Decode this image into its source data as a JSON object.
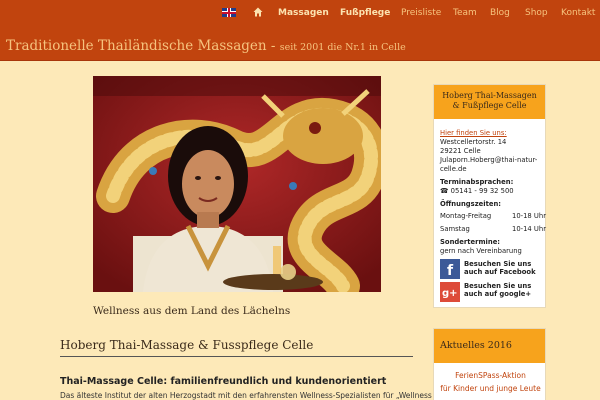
{
  "nav": {
    "items": [
      {
        "label": "Massagen",
        "bold": true
      },
      {
        "label": "Fußpflege",
        "bold": true
      },
      {
        "label": "Preisliste",
        "bold": false
      },
      {
        "label": "Team",
        "bold": false
      },
      {
        "label": "Blog",
        "bold": false
      },
      {
        "label": "Shop",
        "bold": false
      },
      {
        "label": "Kontakt",
        "bold": false
      }
    ],
    "icons": [
      "uk-flag-icon",
      "home-icon"
    ]
  },
  "header": {
    "title": "Traditionelle Thailändische Massagen",
    "separator": " - ",
    "subtitle": "seit 2001 die Nr.1 in Celle"
  },
  "hero": {
    "caption": "Wellness aus dem Land des Lächelns"
  },
  "main": {
    "section_title": "Hoberg Thai-Massage & Fusspflege Celle",
    "sub_heading": "Thai-Massage Celle: familienfreundlich und kundenorientiert",
    "body_text": "Das älteste Institut der alten Herzogstadt mit den erfahrensten Wellness-Spezialisten für „Wellness aus dem Land"
  },
  "sidebar": {
    "contact": {
      "title": "Hoberg Thai-Massagen & Fußpflege Celle",
      "find_us_label": "Hier finden Sie uns:",
      "street": "Westcellertorstr. 14",
      "city": "29221 Celle",
      "email_line1": "Julaporn.Hoberg@thai-natur-",
      "email_line2": "celle.de",
      "appointments_label": "Terminabsprachen:",
      "phone": "☎ 05141 - 99 32 500",
      "hours_label": "Öffnungszeiten:",
      "hours_weekday_label": "Montag-Freitag",
      "hours_weekday": "10-18 Uhr",
      "hours_sat_label": "Samstag",
      "hours_sat": "10-14 Uhr",
      "special_label": "Sondertermine:",
      "special_text": "gern nach Vereinbarung",
      "facebook_line1": "Besuchen Sie uns",
      "facebook_line2": "auch auf Facebook",
      "google_line1": "Besuchen Sie uns",
      "google_line2": "auch auf google+"
    },
    "news": {
      "title": "Aktuelles 2016",
      "line1": "FerienSPass-Aktion",
      "line2": "für Kinder und junge Leute"
    }
  },
  "colors": {
    "brand": "#c1440e",
    "accent": "#f7a31c",
    "background": "#fde9b8"
  }
}
